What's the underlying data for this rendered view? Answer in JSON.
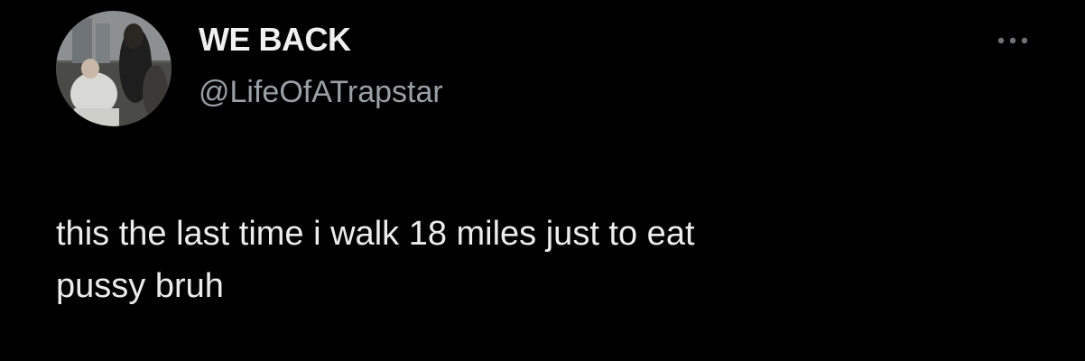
{
  "tweet": {
    "display_name": "WE BACK",
    "handle": "@LifeOfATrapstar",
    "text_lines": [
      "this the last time i walk 18 miles just to eat",
      "pussy bruh"
    ],
    "more_icon": "more-horizontal-icon",
    "avatar": "profile-photo"
  },
  "colors": {
    "background": "#000000",
    "name": "#f0f0f0",
    "handle": "#9aa0a6",
    "text": "#ececec"
  }
}
